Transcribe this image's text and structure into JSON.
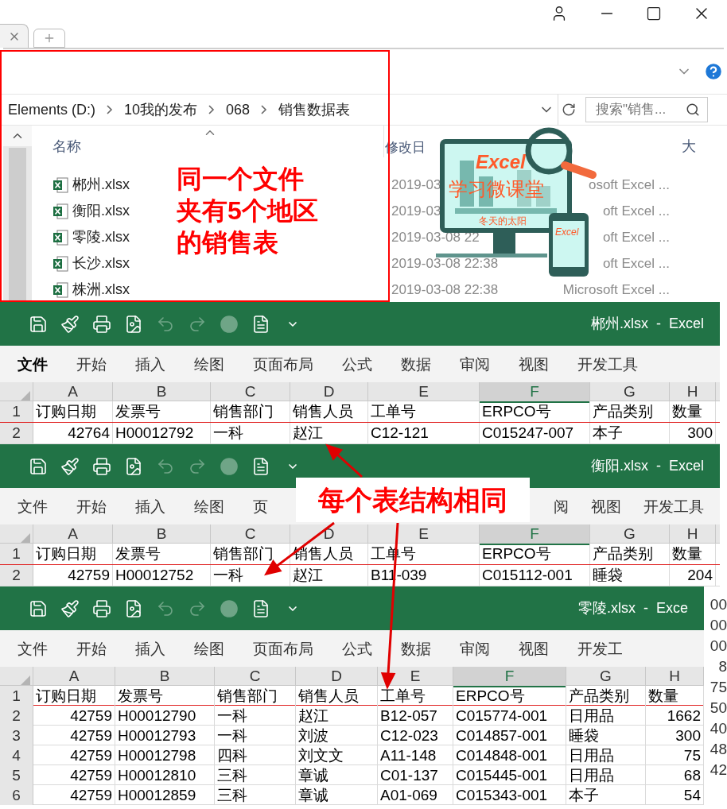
{
  "explorer": {
    "breadcrumb": [
      "Elements (D:)",
      "10我的发布",
      "068",
      "销售数据表"
    ],
    "search": {
      "placeholder": "搜索\"销售..."
    },
    "columns": [
      "名称",
      "修改日",
      "大"
    ],
    "files": [
      {
        "name": "郴州.xlsx",
        "modified": "2019-03",
        "type": "osoft Excel ..."
      },
      {
        "name": "衡阳.xlsx",
        "modified": "2019-03",
        "type": "oft Excel ..."
      },
      {
        "name": "零陵.xlsx",
        "modified": "2019-03-08 22",
        "type": "oft Excel ..."
      },
      {
        "name": "长沙.xlsx",
        "modified": "2019-03-08 22:38",
        "type": "oft Excel ..."
      },
      {
        "name": "株洲.xlsx",
        "modified": "2019-03-08 22:38",
        "type": "Microsoft Excel ..."
      }
    ]
  },
  "annotation": {
    "lines": [
      "同一个文件",
      "夹有5个地区",
      "的销售表"
    ]
  },
  "logo": {
    "title": "Excel",
    "subtitle": "学习微课堂",
    "author": "冬天的太阳",
    "phone_title": "Excel"
  },
  "callout": "每个表结构相同",
  "workbooks": [
    {
      "title": "郴州.xlsx  -  Excel",
      "quick_access": [
        {
          "kind": "save",
          "disabled": false
        },
        {
          "kind": "brush",
          "disabled": false
        },
        {
          "kind": "print",
          "disabled": false
        },
        {
          "kind": "preview",
          "disabled": false
        },
        {
          "kind": "undo",
          "disabled": true
        },
        {
          "kind": "redo",
          "disabled": true
        },
        {
          "kind": "record",
          "disabled": true
        },
        {
          "kind": "document",
          "disabled": false
        },
        {
          "kind": "more",
          "disabled": false
        }
      ],
      "ribbon_tabs": [
        {
          "label": "文件",
          "selected": true
        },
        {
          "label": "开始",
          "selected": false
        },
        {
          "label": "插入",
          "selected": false
        },
        {
          "label": "绘图",
          "selected": false
        },
        {
          "label": "页面布局",
          "selected": false
        },
        {
          "label": "公式",
          "selected": false
        },
        {
          "label": "数据",
          "selected": false
        },
        {
          "label": "审阅",
          "selected": false
        },
        {
          "label": "视图",
          "selected": false
        },
        {
          "label": "开发工具",
          "selected": false
        }
      ],
      "column_headers": [
        {
          "label": "A",
          "selected": false
        },
        {
          "label": "B",
          "selected": false
        },
        {
          "label": "C",
          "selected": false
        },
        {
          "label": "D",
          "selected": false
        },
        {
          "label": "E",
          "selected": false
        },
        {
          "label": "F",
          "selected": true
        },
        {
          "label": "G",
          "selected": false
        },
        {
          "label": "H",
          "selected": false
        }
      ],
      "rows": [
        {
          "number": "1",
          "cells": [
            "订购日期",
            "发票号",
            "销售部门",
            "销售人员",
            "工单号",
            "ERPCO号",
            "产品类别",
            "数量"
          ]
        },
        {
          "number": "2",
          "cells": [
            "42764",
            "H00012792",
            "一科",
            "赵江",
            "C12-121",
            "C015247-007",
            "本子",
            "300"
          ]
        }
      ]
    },
    {
      "title": "衡阳.xlsx  -  Excel",
      "quick_access": [
        {
          "kind": "save",
          "disabled": false
        },
        {
          "kind": "brush",
          "disabled": false
        },
        {
          "kind": "print",
          "disabled": false
        },
        {
          "kind": "preview",
          "disabled": false
        },
        {
          "kind": "undo",
          "disabled": true
        },
        {
          "kind": "redo",
          "disabled": true
        },
        {
          "kind": "record",
          "disabled": true
        },
        {
          "kind": "document",
          "disabled": false
        },
        {
          "kind": "more",
          "disabled": false
        }
      ],
      "ribbon_tabs": [
        {
          "label": "文件",
          "selected": false
        },
        {
          "label": "开始",
          "selected": false
        },
        {
          "label": "插入",
          "selected": false
        },
        {
          "label": "绘图",
          "selected": false
        },
        {
          "label": "页",
          "selected": false
        }
      ],
      "ribbon_tabs_right": [
        {
          "label": "阅",
          "selected": false
        },
        {
          "label": "视图",
          "selected": false
        },
        {
          "label": "开发工具",
          "selected": false
        }
      ],
      "column_headers": [
        {
          "label": "A",
          "selected": false
        },
        {
          "label": "B",
          "selected": false
        },
        {
          "label": "C",
          "selected": false
        },
        {
          "label": "D",
          "selected": false
        },
        {
          "label": "E",
          "selected": false
        },
        {
          "label": "F",
          "selected": true
        },
        {
          "label": "G",
          "selected": false
        },
        {
          "label": "H",
          "selected": false
        }
      ],
      "rows": [
        {
          "number": "1",
          "cells": [
            "订购日期",
            "发票号",
            "销售部门",
            "销售人员",
            "工单号",
            "ERPCO号",
            "产品类别",
            "数量"
          ]
        },
        {
          "number": "2",
          "cells": [
            "42759",
            "H00012752",
            "一科",
            "赵江",
            "B11-039",
            "C015112-001",
            "睡袋",
            "204"
          ]
        }
      ]
    },
    {
      "title": "零陵.xlsx  -  Exce",
      "quick_access": [
        {
          "kind": "save",
          "disabled": false
        },
        {
          "kind": "brush",
          "disabled": false
        },
        {
          "kind": "print",
          "disabled": false
        },
        {
          "kind": "preview",
          "disabled": false
        },
        {
          "kind": "undo",
          "disabled": true
        },
        {
          "kind": "redo",
          "disabled": true
        },
        {
          "kind": "record",
          "disabled": true
        },
        {
          "kind": "document",
          "disabled": false
        },
        {
          "kind": "more",
          "disabled": false
        }
      ],
      "ribbon_tabs": [
        {
          "label": "文件",
          "selected": false
        },
        {
          "label": "开始",
          "selected": false
        },
        {
          "label": "插入",
          "selected": false
        },
        {
          "label": "绘图",
          "selected": false
        },
        {
          "label": "页面布局",
          "selected": false
        },
        {
          "label": "公式",
          "selected": false
        },
        {
          "label": "数据",
          "selected": false
        },
        {
          "label": "审阅",
          "selected": false
        },
        {
          "label": "视图",
          "selected": false
        },
        {
          "label": "开发工",
          "selected": false
        }
      ],
      "column_headers": [
        {
          "label": "A",
          "selected": false
        },
        {
          "label": "B",
          "selected": false
        },
        {
          "label": "C",
          "selected": false
        },
        {
          "label": "D",
          "selected": false
        },
        {
          "label": "E",
          "selected": false
        },
        {
          "label": "F",
          "selected": true
        },
        {
          "label": "G",
          "selected": false
        },
        {
          "label": "H",
          "selected": false
        }
      ],
      "rows": [
        {
          "number": "1",
          "cells": [
            "订购日期",
            "发票号",
            "销售部门",
            "销售人员",
            "工单号",
            "ERPCO号",
            "产品类别",
            "数量"
          ]
        },
        {
          "number": "2",
          "cells": [
            "42759",
            "H00012790",
            "一科",
            "赵江",
            "B12-057",
            "C015774-001",
            "日用品",
            "1662"
          ]
        },
        {
          "number": "3",
          "cells": [
            "42759",
            "H00012793",
            "一科",
            "刘波",
            "C12-023",
            "C014857-001",
            "睡袋",
            "300"
          ]
        },
        {
          "number": "4",
          "cells": [
            "42759",
            "H00012798",
            "四科",
            "刘文文",
            "A11-148",
            "C014848-001",
            "日用品",
            "75"
          ]
        },
        {
          "number": "5",
          "cells": [
            "42759",
            "H00012810",
            "三科",
            "章诚",
            "C01-137",
            "C015445-001",
            "日用品",
            "68"
          ]
        },
        {
          "number": "6",
          "cells": [
            "42759",
            "H00012859",
            "三科",
            "章诚",
            "A01-069",
            "C015343-001",
            "本子",
            "54"
          ]
        }
      ]
    }
  ],
  "peek_values": [
    "00",
    "00",
    "00",
    "8",
    "75",
    "50",
    "40",
    "48",
    "42"
  ]
}
